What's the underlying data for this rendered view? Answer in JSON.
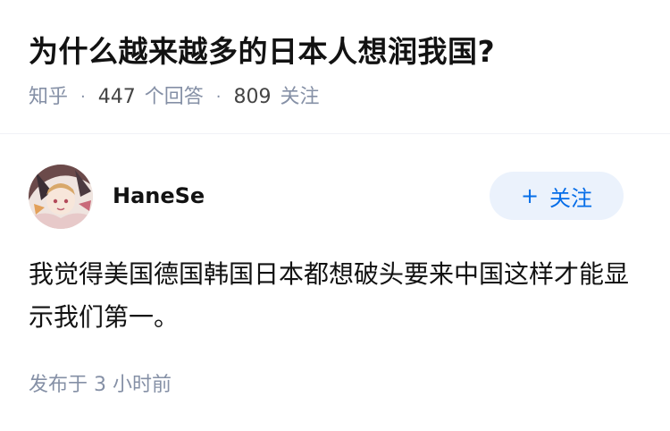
{
  "question": {
    "title": "为什么越来越多的日本人想润我国?",
    "source": "知乎",
    "answers_count": "447",
    "answers_label": "个回答",
    "followers_count": "809",
    "followers_label": "关注"
  },
  "answer": {
    "author_name": "HaneSe",
    "follow_label": "关注",
    "follow_icon": "+",
    "content": "我觉得美国德国韩国日本都想破头要来中国这样才能显示我们第一。",
    "published": "发布于  3 小时前"
  },
  "colors": {
    "meta_text": "#8590a6",
    "accent": "#056de8",
    "button_bg": "#ebf2fc"
  }
}
